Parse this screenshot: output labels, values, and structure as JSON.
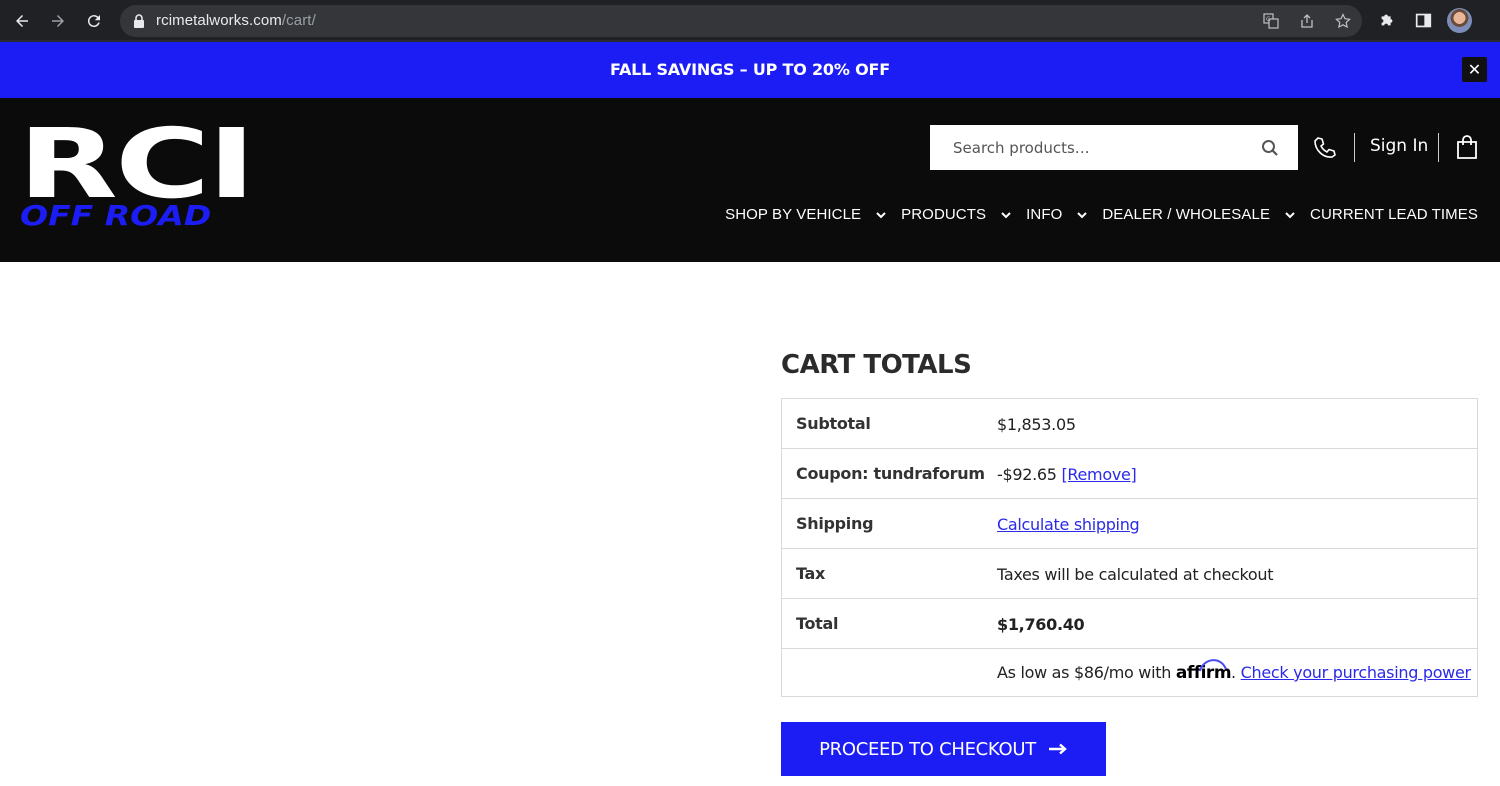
{
  "browser": {
    "url_host": "rcimetalworks.com",
    "url_path": "/cart/"
  },
  "promo": {
    "text": "FALL SAVINGS – UP TO 20% OFF",
    "close_label": "✕"
  },
  "header": {
    "logo_top": "RCI",
    "logo_bottom": "OFF ROAD",
    "search_placeholder": "Search products…",
    "sign_in": "Sign In",
    "nav": [
      {
        "label": "SHOP BY VEHICLE",
        "has_dropdown": true
      },
      {
        "label": "PRODUCTS",
        "has_dropdown": true
      },
      {
        "label": "INFO",
        "has_dropdown": true
      },
      {
        "label": "DEALER / WHOLESALE",
        "has_dropdown": true
      },
      {
        "label": "CURRENT LEAD TIMES",
        "has_dropdown": false
      }
    ]
  },
  "cart_totals": {
    "title": "CART TOTALS",
    "subtotal_label": "Subtotal",
    "subtotal_value": "$1,853.05",
    "coupon_label": "Coupon: tundraforum",
    "coupon_value": "-$92.65",
    "coupon_remove": "[Remove]",
    "shipping_label": "Shipping",
    "shipping_link": "Calculate shipping",
    "tax_label": "Tax",
    "tax_value": "Taxes will be calculated at checkout",
    "total_label": "Total",
    "total_value": "$1,760.40",
    "affirm_prefix": "As low as $86/mo with",
    "affirm_brand": "affirm",
    "affirm_dot": ".",
    "affirm_link": "Check your purchasing power",
    "checkout_button": "PROCEED TO CHECKOUT"
  },
  "colors": {
    "brand_blue": "#1c1cf5",
    "header_bg": "#0b0b0b",
    "link_blue": "#2a2ae8"
  }
}
